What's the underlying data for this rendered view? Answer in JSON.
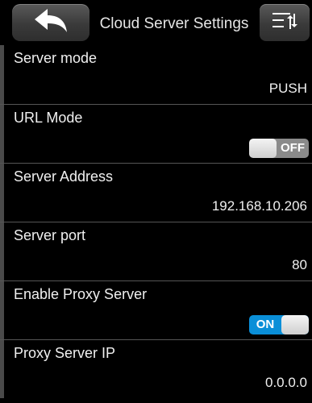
{
  "header": {
    "title": "Cloud Server Settings",
    "back_icon": "back-arrow-icon",
    "menu_icon": "sort-menu-icon"
  },
  "settings": [
    {
      "label": "Server mode",
      "value": "PUSH"
    },
    {
      "label": "URL Mode",
      "toggle": "OFF",
      "enabled": false
    },
    {
      "label": "Server Address",
      "value": "192.168.10.206"
    },
    {
      "label": "Server port",
      "value": "80"
    },
    {
      "label": "Enable Proxy Server",
      "toggle": "ON",
      "enabled": true
    },
    {
      "label": "Proxy Server IP",
      "value": "0.0.0.0"
    }
  ],
  "colors": {
    "background": "#000000",
    "toggle_on": "#0a8fd8",
    "toggle_off": "#8a8a8a"
  }
}
